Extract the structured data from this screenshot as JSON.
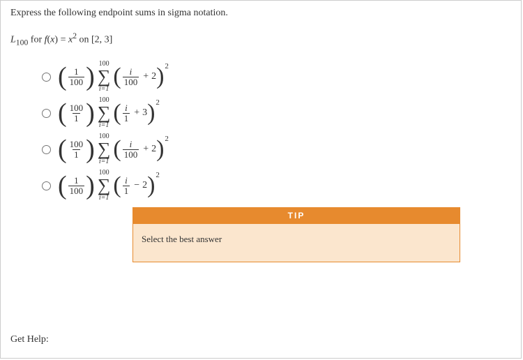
{
  "prompt": "Express the following endpoint sums in sigma notation.",
  "sub_label": "L",
  "sub_index": "100",
  "sub_mid": " for ",
  "func_lhs": "f",
  "func_lparen": "(",
  "func_var": "x",
  "func_rparen": ")",
  "eq": " = ",
  "rhs_base": "x",
  "rhs_exp": "2",
  "on_text": " on ",
  "interval": "[2, 3]",
  "sigma_glyph": "∑",
  "options": [
    {
      "coef_num": "1",
      "coef_den": "100",
      "upper": "100",
      "lower": "i=1",
      "inner_num": "i",
      "inner_den": "100",
      "op": "+",
      "const": "2",
      "exp": "2"
    },
    {
      "coef_num": "100",
      "coef_den": "1",
      "upper": "100",
      "lower": "i=1",
      "inner_num": "i",
      "inner_den": "1",
      "op": "+",
      "const": "3",
      "exp": "2"
    },
    {
      "coef_num": "100",
      "coef_den": "1",
      "upper": "100",
      "lower": "i=1",
      "inner_num": "i",
      "inner_den": "100",
      "op": "+",
      "const": "2",
      "exp": "2"
    },
    {
      "coef_num": "1",
      "coef_den": "100",
      "upper": "100",
      "lower": "i=1",
      "inner_num": "i",
      "inner_den": "1",
      "op": "−",
      "const": "2",
      "exp": "2"
    }
  ],
  "tip": {
    "header": "TIP",
    "body": "Select the best answer"
  },
  "gethelp": "Get Help:"
}
